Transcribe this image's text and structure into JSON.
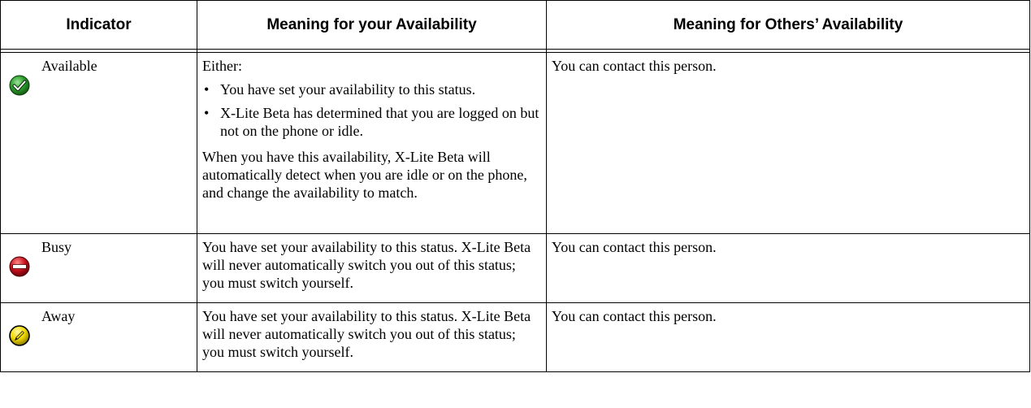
{
  "table": {
    "headers": {
      "indicator": "Indicator",
      "meaning_yours": "Meaning for your Availability",
      "meaning_others": "Meaning for Others’ Availability"
    },
    "rows": [
      {
        "icon": "available-check-icon",
        "icon_color": "#2e9e2e",
        "label": "Available",
        "yours_intro": "Either:",
        "yours_bullets": [
          "You have set your availability to this status.",
          "X-Lite Beta has determined that you are logged on but not on the phone or idle."
        ],
        "yours_note": "When you have this availability, X-Lite Beta will automatically detect when you are idle or on the phone, and change the availability to match.",
        "others": "You can contact this person."
      },
      {
        "icon": "busy-minus-icon",
        "icon_color": "#c8101e",
        "label": "Busy",
        "yours": "You have set your availability to this status. X-Lite Beta will never automatically switch you out of this status; you must switch yourself.",
        "others": "You can contact this person."
      },
      {
        "icon": "away-pencil-icon",
        "icon_color": "#f0d800",
        "label": "Away",
        "yours": "You have set your availability to this status. X-Lite Beta will never automatically switch you out of this status; you must switch yourself.",
        "others": "You can contact this person."
      }
    ]
  }
}
